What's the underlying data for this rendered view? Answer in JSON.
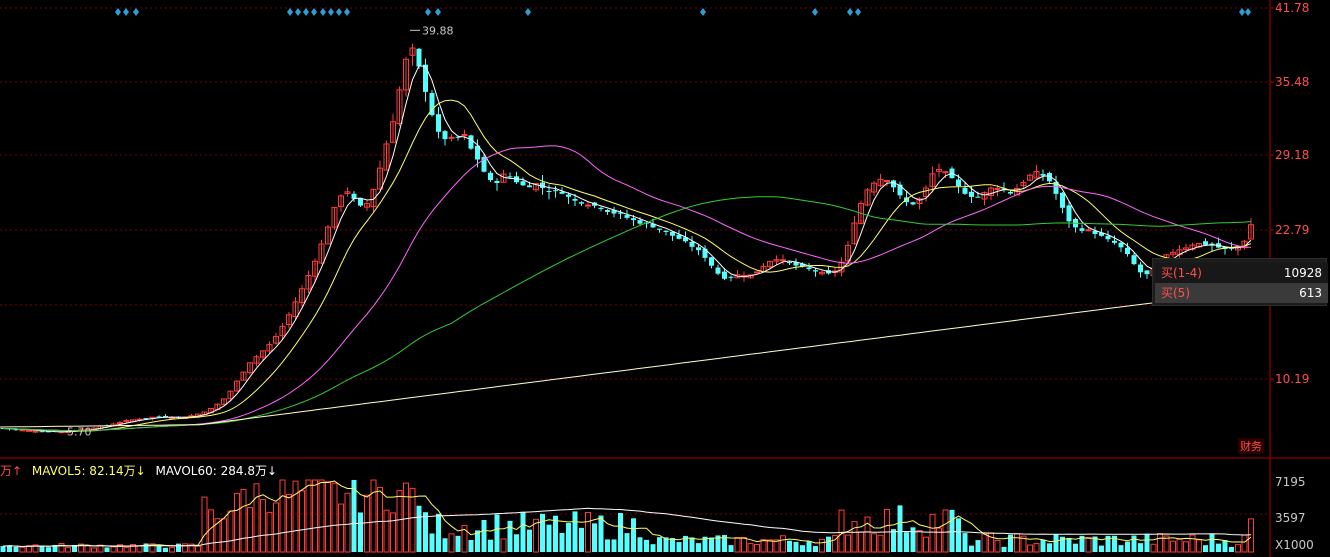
{
  "chart_data": {
    "type": "candlestick",
    "price_axis": {
      "ticks": [
        "41.78",
        "35.48",
        "29.18",
        "22.79",
        "10.19"
      ],
      "tick_values": [
        41.78,
        35.48,
        29.18,
        22.79,
        10.19
      ],
      "ylim": [
        5.3,
        41.78
      ],
      "grid": "dotted-red"
    },
    "annotations": {
      "high_label": "39.88",
      "low_label": "5.70"
    },
    "price_path": [
      [
        0,
        6.0
      ],
      [
        15,
        5.9
      ],
      [
        30,
        5.8
      ],
      [
        50,
        5.72
      ],
      [
        65,
        5.7
      ],
      [
        85,
        5.9
      ],
      [
        110,
        6.3
      ],
      [
        125,
        6.6
      ],
      [
        140,
        6.8
      ],
      [
        160,
        7.0
      ],
      [
        180,
        6.9
      ],
      [
        195,
        7.1
      ],
      [
        210,
        7.6
      ],
      [
        222,
        8.3
      ],
      [
        232,
        9.3
      ],
      [
        240,
        10.4
      ],
      [
        250,
        11.6
      ],
      [
        262,
        12.5
      ],
      [
        272,
        13.3
      ],
      [
        282,
        14.6
      ],
      [
        290,
        15.8
      ],
      [
        298,
        17.2
      ],
      [
        306,
        18.5
      ],
      [
        314,
        20.1
      ],
      [
        320,
        21.3
      ],
      [
        326,
        22.7
      ],
      [
        333,
        24.4
      ],
      [
        340,
        25.8
      ],
      [
        348,
        26.2
      ],
      [
        356,
        25.2
      ],
      [
        364,
        24.6
      ],
      [
        372,
        26.0
      ],
      [
        378,
        27.5
      ],
      [
        385,
        29.8
      ],
      [
        392,
        31.8
      ],
      [
        398,
        34.2
      ],
      [
        404,
        36.6
      ],
      [
        410,
        38.8
      ],
      [
        418,
        37.0
      ],
      [
        426,
        34.6
      ],
      [
        434,
        32.1
      ],
      [
        440,
        30.8
      ],
      [
        448,
        30.6
      ],
      [
        456,
        30.7
      ],
      [
        464,
        31.0
      ],
      [
        472,
        29.6
      ],
      [
        480,
        28.6
      ],
      [
        488,
        27.1
      ],
      [
        496,
        26.9
      ],
      [
        504,
        27.6
      ],
      [
        512,
        27.4
      ],
      [
        520,
        26.7
      ],
      [
        528,
        26.6
      ],
      [
        536,
        26.8
      ],
      [
        544,
        26.4
      ],
      [
        552,
        26.1
      ],
      [
        560,
        26.2
      ],
      [
        568,
        25.7
      ],
      [
        576,
        25.3
      ],
      [
        584,
        25.2
      ],
      [
        592,
        25.0
      ],
      [
        600,
        24.8
      ],
      [
        610,
        24.4
      ],
      [
        620,
        24.2
      ],
      [
        630,
        23.8
      ],
      [
        640,
        23.5
      ],
      [
        650,
        23.3
      ],
      [
        660,
        22.9
      ],
      [
        670,
        22.5
      ],
      [
        680,
        22.1
      ],
      [
        690,
        21.6
      ],
      [
        700,
        21.0
      ],
      [
        708,
        20.3
      ],
      [
        716,
        19.3
      ],
      [
        724,
        18.8
      ],
      [
        732,
        18.9
      ],
      [
        740,
        19.1
      ],
      [
        750,
        19.0
      ],
      [
        758,
        19.4
      ],
      [
        766,
        20.0
      ],
      [
        774,
        20.5
      ],
      [
        782,
        20.3
      ],
      [
        790,
        20.0
      ],
      [
        798,
        19.8
      ],
      [
        806,
        19.6
      ],
      [
        814,
        19.4
      ],
      [
        822,
        19.2
      ],
      [
        830,
        19.1
      ],
      [
        838,
        19.6
      ],
      [
        846,
        20.8
      ],
      [
        852,
        22.9
      ],
      [
        858,
        24.5
      ],
      [
        864,
        25.8
      ],
      [
        870,
        26.7
      ],
      [
        878,
        27.2
      ],
      [
        886,
        27.3
      ],
      [
        894,
        26.5
      ],
      [
        902,
        25.5
      ],
      [
        910,
        25.0
      ],
      [
        918,
        25.3
      ],
      [
        926,
        26.4
      ],
      [
        932,
        27.6
      ],
      [
        938,
        28.1
      ],
      [
        946,
        27.7
      ],
      [
        954,
        27.0
      ],
      [
        962,
        26.2
      ],
      [
        970,
        25.8
      ],
      [
        978,
        25.7
      ],
      [
        986,
        26.1
      ],
      [
        994,
        26.6
      ],
      [
        1002,
        26.4
      ],
      [
        1010,
        26.0
      ],
      [
        1018,
        26.5
      ],
      [
        1026,
        27.2
      ],
      [
        1034,
        27.8
      ],
      [
        1042,
        27.6
      ],
      [
        1050,
        27.0
      ],
      [
        1058,
        25.6
      ],
      [
        1066,
        24.0
      ],
      [
        1074,
        23.1
      ],
      [
        1082,
        22.9
      ],
      [
        1090,
        22.8
      ],
      [
        1098,
        22.5
      ],
      [
        1106,
        22.1
      ],
      [
        1114,
        21.8
      ],
      [
        1122,
        21.3
      ],
      [
        1130,
        20.5
      ],
      [
        1138,
        19.4
      ],
      [
        1146,
        19.0
      ],
      [
        1154,
        19.6
      ],
      [
        1162,
        20.4
      ],
      [
        1170,
        20.9
      ],
      [
        1178,
        21.2
      ],
      [
        1186,
        21.4
      ],
      [
        1194,
        21.7
      ],
      [
        1202,
        21.7
      ],
      [
        1210,
        21.6
      ],
      [
        1218,
        21.4
      ],
      [
        1226,
        21.2
      ],
      [
        1234,
        21.3
      ],
      [
        1242,
        21.6
      ],
      [
        1248,
        22.5
      ],
      [
        1256,
        24.7
      ]
    ],
    "ma_lines": [
      {
        "color": "#ffffff",
        "lag": 4
      },
      {
        "color": "#ffff66",
        "lag": 10
      },
      {
        "color": "#ff66ff",
        "lag": 28
      },
      {
        "color": "#33cc33",
        "lag": 70
      },
      {
        "color": "#ffffcc",
        "lag": "long"
      }
    ],
    "volume_axis": {
      "ticks": [
        "7195",
        "3597",
        "X1000"
      ],
      "tick_values": [
        7195,
        3597,
        0
      ]
    },
    "volume_legend": {
      "partial": "万↑",
      "mavol5": "MAVOL5: 82.14万↓",
      "mavol60": "MAVOL60: 284.8万↓"
    }
  },
  "tooltip": {
    "buy_1_4_label": "买(1-4)",
    "buy_1_4_value": "10928",
    "buy_5_label": "买(5)",
    "buy_5_value": "613"
  },
  "finance_tag": "财务",
  "colors": {
    "up": "#ff3b3b",
    "down": "#54ffff",
    "grid": "#7a0000",
    "axis": "#ff4d4d",
    "diamond": "#2a9fd6"
  }
}
